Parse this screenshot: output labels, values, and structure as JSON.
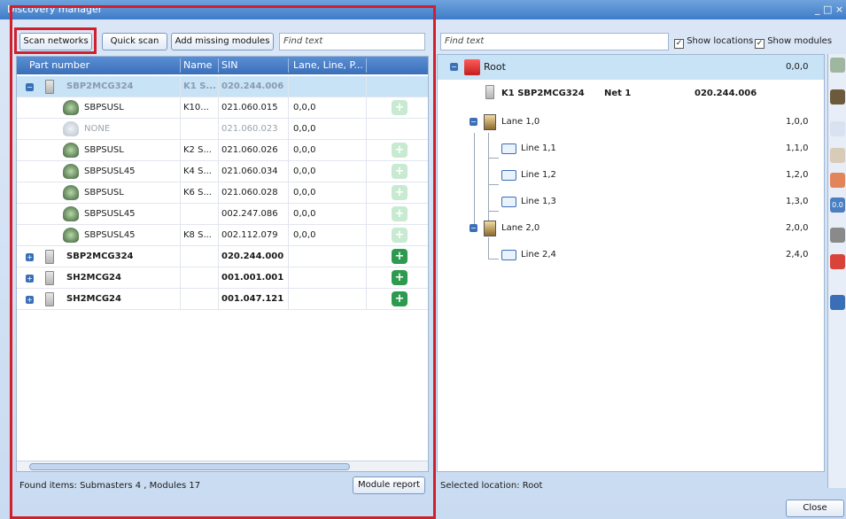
{
  "window": {
    "title": "Discovery manager",
    "controls": "_ □ ×"
  },
  "toolbar": {
    "scan_networks": "Scan networks",
    "quick_scan": "Quick scan",
    "add_missing": "Add missing modules",
    "find_text_left": "Find text",
    "find_text_right": "Find text",
    "show_locations": "Show locations",
    "show_modules": "Show modules"
  },
  "grid": {
    "columns": [
      "Part number",
      "Name",
      "SIN",
      "Lane, Line, P..."
    ],
    "rows": [
      {
        "part": "SBP2MCG324",
        "name": "K1 S...",
        "sin": "020.244.006",
        "loc": "",
        "level": 0,
        "expander": "⊟",
        "style": "selected",
        "plus": ""
      },
      {
        "part": "SBPSUSL",
        "name": "K10...",
        "sin": "021.060.015",
        "loc": "0,0,0",
        "level": 1,
        "style": "normal",
        "plus": "light"
      },
      {
        "part": "NONE",
        "name": "",
        "sin": "021.060.023",
        "loc": "0,0,0",
        "level": 1,
        "style": "disabled",
        "plus": ""
      },
      {
        "part": "SBPSUSL",
        "name": "K2 S...",
        "sin": "021.060.026",
        "loc": "0,0,0",
        "level": 1,
        "style": "normal",
        "plus": "light"
      },
      {
        "part": "SBPSUSL45",
        "name": "K4 S...",
        "sin": "021.060.034",
        "loc": "0,0,0",
        "level": 1,
        "style": "normal",
        "plus": "light"
      },
      {
        "part": "SBPSUSL",
        "name": "K6 S...",
        "sin": "021.060.028",
        "loc": "0,0,0",
        "level": 1,
        "style": "normal",
        "plus": "light"
      },
      {
        "part": "SBPSUSL45",
        "name": "",
        "sin": "002.247.086",
        "loc": "0,0,0",
        "level": 1,
        "style": "normal",
        "plus": "light"
      },
      {
        "part": "SBPSUSL45",
        "name": "K8 S...",
        "sin": "002.112.079",
        "loc": "0,0,0",
        "level": 1,
        "style": "normal",
        "plus": "light"
      },
      {
        "part": "SBP2MCG324",
        "name": "",
        "sin": "020.244.000",
        "loc": "",
        "level": 0,
        "expander": "⊞",
        "style": "bold",
        "plus": "strong"
      },
      {
        "part": "SH2MCG24",
        "name": "",
        "sin": "001.001.001",
        "loc": "",
        "level": 0,
        "expander": "⊞",
        "style": "bold",
        "plus": "strong"
      },
      {
        "part": "SH2MCG24",
        "name": "",
        "sin": "001.047.121",
        "loc": "",
        "level": 0,
        "expander": "⊞",
        "style": "bold",
        "plus": "strong"
      }
    ]
  },
  "status": {
    "found_items": "Found items: Submasters 4 , Modules 17",
    "module_report": "Module report",
    "selected_location": "Selected location: Root",
    "close": "Close"
  },
  "tree": {
    "root": {
      "label": "Root",
      "value": "0,0,0"
    },
    "module": {
      "label": "K1 SBP2MCG324",
      "net": "Net 1",
      "sin": "020.244.006"
    },
    "lanes": [
      {
        "label": "Lane 1,0",
        "value": "1,0,0",
        "lines": [
          {
            "label": "Line 1,1",
            "value": "1,1,0"
          },
          {
            "label": "Line 1,2",
            "value": "1,2,0"
          },
          {
            "label": "Line 1,3",
            "value": "1,3,0"
          }
        ]
      },
      {
        "label": "Lane 2,0",
        "value": "2,0,0",
        "lines": [
          {
            "label": "Line 2,4",
            "value": "2,4,0"
          }
        ]
      }
    ]
  },
  "colors": {
    "highlight": "#d11f2b",
    "selection": "#c8e2f6",
    "header": "#3a6fb8",
    "add_green": "#2d9b4f"
  },
  "sidebar_icons": [
    "toolbox-icon",
    "module-icon",
    "network-icon",
    "hand-icon",
    "tag-icon",
    "counter-icon",
    "tools-icon",
    "stop-icon",
    "grid-icon"
  ]
}
